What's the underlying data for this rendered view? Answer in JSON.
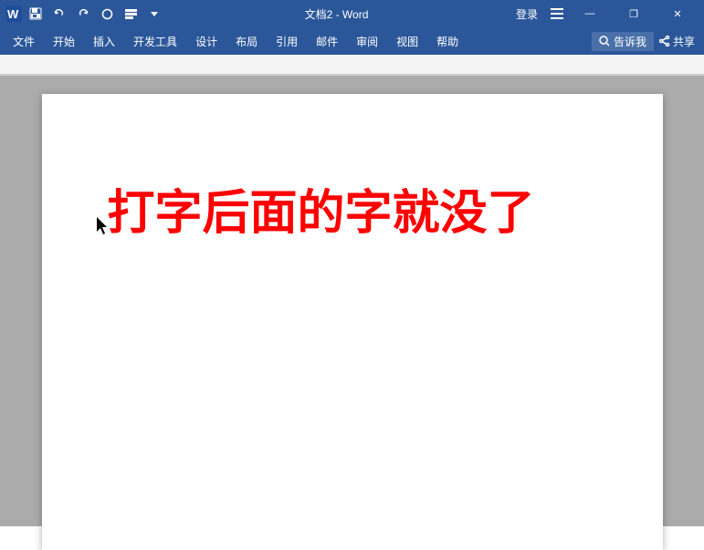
{
  "titlebar": {
    "title": "文档2 - Word",
    "login_label": "登录",
    "share_label": "共享",
    "search_label": "告诉我",
    "minimize_symbol": "—",
    "restore_symbol": "❐",
    "close_symbol": "✕"
  },
  "menubar": {
    "items": [
      {
        "label": "文件"
      },
      {
        "label": "开始"
      },
      {
        "label": "插入"
      },
      {
        "label": "开发工具"
      },
      {
        "label": "设计"
      },
      {
        "label": "布局"
      },
      {
        "label": "引用"
      },
      {
        "label": "邮件"
      },
      {
        "label": "审阅"
      },
      {
        "label": "视图"
      },
      {
        "label": "帮助"
      }
    ]
  },
  "document": {
    "content": "打字后面的字就没了"
  }
}
